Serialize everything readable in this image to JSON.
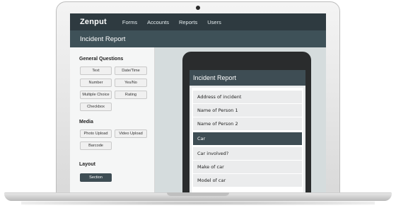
{
  "app": {
    "logo": "Zenput",
    "nav": [
      "Forms",
      "Accounts",
      "Reports",
      "Users"
    ]
  },
  "page": {
    "title": "Incident Report"
  },
  "sidebar": {
    "general_title": "General Questions",
    "general_buttons": [
      "Text",
      "Date/Time",
      "Number",
      "Yes/No",
      "Multiple Choice",
      "Rating",
      "Checkbox"
    ],
    "media_title": "Media",
    "media_buttons": [
      "Photo Upload",
      "Video Upload",
      "Barcode"
    ],
    "layout_title": "Layout",
    "layout_buttons": [
      "Section"
    ]
  },
  "preview": {
    "title": "Incident Report",
    "rows": [
      "Address of incident",
      "Name of Person 1",
      "Name of Person 2",
      "Car",
      "Car involved?",
      "Make of car",
      "Model of car"
    ],
    "selected_row": "Car"
  },
  "colors": {
    "nav_bg": "#2e3a40",
    "title_bg": "#3e5158",
    "accent": "#3e4d54"
  }
}
